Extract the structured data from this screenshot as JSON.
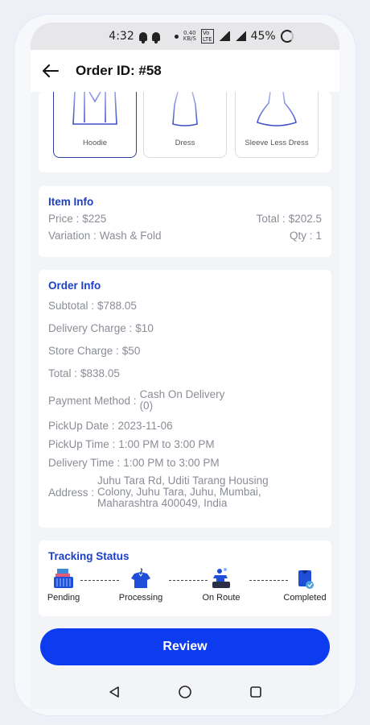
{
  "status_bar": {
    "time": "4:32",
    "net_speed_top": "0.40",
    "net_speed_bottom": "KB/S",
    "battery": "45%"
  },
  "header": {
    "title": "Order ID: #58"
  },
  "products": [
    {
      "label": "Hoodie",
      "selected": true
    },
    {
      "label": "Dress",
      "selected": false
    },
    {
      "label": "Sleeve Less Dress",
      "selected": false
    }
  ],
  "item_info": {
    "title": "Item Info",
    "price_label": "Price :",
    "price_value": "$225",
    "total_label": "Total :",
    "total_value": "$202.5",
    "variation_label": "Variation :",
    "variation_value": "Wash & Fold",
    "qty_label": "Qty :",
    "qty_value": "1"
  },
  "order_info": {
    "title": "Order Info",
    "subtotal_label": "Subtotal :",
    "subtotal_value": "$788.05",
    "delivery_label": "Delivery Charge :",
    "delivery_value": "$10",
    "store_label": "Store Charge :",
    "store_value": "$50",
    "total_label": "Total :",
    "total_value": "$838.05",
    "payment_label": "Payment Method :",
    "payment_value_1": "Cash On Delivery",
    "payment_value_2": "(0)",
    "pickup_date_label": "PickUp Date :",
    "pickup_date_value": "2023-11-06",
    "pickup_time_label": "PickUp Time :",
    "pickup_time_value": "1:00 PM to 3:00 PM",
    "delivery_time_label": "Delivery Time :",
    "delivery_time_value": "1:00 PM to 3:00 PM",
    "address_label": "Address :",
    "address_1": "Juhu Tara Rd, Uditi Tarang Housing",
    "address_2": "Colony, Juhu Tara, Juhu, Mumbai,",
    "address_3": "Maharashtra 400049, India"
  },
  "tracking": {
    "title": "Tracking Status",
    "steps": [
      {
        "label": "Pending",
        "icon": "laundry-basket-icon"
      },
      {
        "label": "Processing",
        "icon": "shirt-hanger-icon"
      },
      {
        "label": "On Route",
        "icon": "washing-icon"
      },
      {
        "label": "Completed",
        "icon": "folded-shirt-icon"
      }
    ]
  },
  "review_button": "Review",
  "colors": {
    "accent": "#0c3bf0",
    "section_title": "#1d3fc7"
  }
}
